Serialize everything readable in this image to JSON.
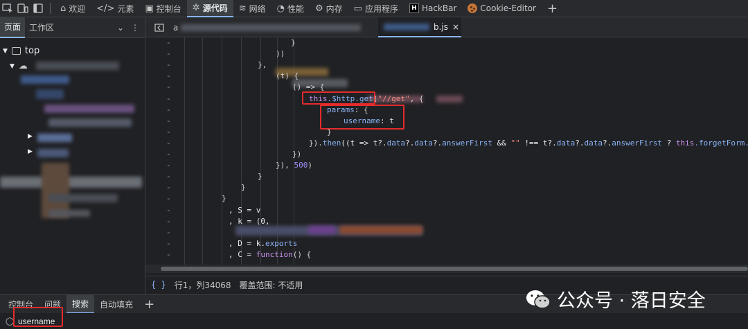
{
  "toolbar": {
    "tabs": [
      {
        "label": "欢迎",
        "icon": "home-icon"
      },
      {
        "label": "元素",
        "icon": "code-brackets-icon"
      },
      {
        "label": "控制台",
        "icon": "console-icon"
      },
      {
        "label": "源代码",
        "icon": "bug-icon"
      },
      {
        "label": "网络",
        "icon": "wifi-icon"
      },
      {
        "label": "性能",
        "icon": "performance-icon"
      },
      {
        "label": "内存",
        "icon": "memory-icon"
      },
      {
        "label": "应用程序",
        "icon": "application-icon"
      },
      {
        "label": "HackBar",
        "icon": "hackbar-icon"
      },
      {
        "label": "Cookie-Editor",
        "icon": "cookie-icon"
      }
    ],
    "add_label": "+"
  },
  "sidebar": {
    "tab_page": "页面",
    "tab_workspace": "工作区",
    "tree_top": "top"
  },
  "editor": {
    "tab_first": "a",
    "tab_active": "b.js",
    "close_glyph": "×",
    "lines": [
      {
        "mark": "-",
        "tokens": [
          {
            "t": "}",
            "c": "t-punc"
          }
        ]
      },
      {
        "mark": "-",
        "tokens": [
          {
            "t": "))",
            "c": "t-punc"
          }
        ]
      },
      {
        "mark": "-",
        "tokens": [
          {
            "t": "},",
            "c": "t-punc"
          }
        ]
      },
      {
        "mark": "-",
        "tokens": [
          {
            "t": "(t) {",
            "c": "t-punc"
          }
        ]
      },
      {
        "mark": "-",
        "tokens": [
          {
            "t": "() => {",
            "c": "t-punc"
          }
        ]
      },
      {
        "mark": "-",
        "tokens": [
          {
            "t": "this",
            "c": "t-kw"
          },
          {
            "t": ".$http.get",
            "c": "t-prop"
          },
          {
            "t": "(",
            "c": "t-punc"
          },
          {
            "t": "\"/",
            "c": "t-str"
          },
          {
            "t": "/get",
            "c": "t-str"
          },
          {
            "t": "\"",
            "c": "t-str"
          },
          {
            "t": ", {",
            "c": "t-punc"
          }
        ]
      },
      {
        "mark": "-",
        "tokens": [
          {
            "t": "params",
            "c": "t-prop"
          },
          {
            "t": ": {",
            "c": "t-punc"
          }
        ]
      },
      {
        "mark": "-",
        "tokens": [
          {
            "t": "username",
            "c": "t-prop"
          },
          {
            "t": ": t",
            "c": "t-plain"
          }
        ]
      },
      {
        "mark": "-",
        "tokens": [
          {
            "t": "}",
            "c": "t-punc"
          }
        ]
      },
      {
        "mark": "-",
        "tokens": [
          {
            "t": "}).",
            "c": "t-punc"
          },
          {
            "t": "then",
            "c": "t-prop"
          },
          {
            "t": "((t => t?.",
            "c": "t-plain"
          },
          {
            "t": "data",
            "c": "t-prop"
          },
          {
            "t": "?.",
            "c": "t-plain"
          },
          {
            "t": "data",
            "c": "t-prop"
          },
          {
            "t": "?.",
            "c": "t-plain"
          },
          {
            "t": "answerFirst",
            "c": "t-prop"
          },
          {
            "t": " && ",
            "c": "t-plain"
          },
          {
            "t": "\"\"",
            "c": "t-str"
          },
          {
            "t": " !== t?.",
            "c": "t-plain"
          },
          {
            "t": "data",
            "c": "t-prop"
          },
          {
            "t": "?.",
            "c": "t-plain"
          },
          {
            "t": "data",
            "c": "t-prop"
          },
          {
            "t": "?.",
            "c": "t-plain"
          },
          {
            "t": "answerFirst",
            "c": "t-prop"
          },
          {
            "t": " ? ",
            "c": "t-plain"
          },
          {
            "t": "this",
            "c": "t-kw"
          },
          {
            "t": ".forgetForm.answ",
            "c": "t-prop"
          }
        ]
      },
      {
        "mark": "-",
        "tokens": [
          {
            "t": "})",
            "c": "t-punc"
          }
        ]
      },
      {
        "mark": "-",
        "tokens": [
          {
            "t": "}), ",
            "c": "t-punc"
          },
          {
            "t": "500",
            "c": "t-num"
          },
          {
            "t": ")",
            "c": "t-punc"
          }
        ]
      },
      {
        "mark": "-",
        "tokens": [
          {
            "t": "}",
            "c": "t-punc"
          }
        ]
      },
      {
        "mark": "-",
        "tokens": [
          {
            "t": "}",
            "c": "t-punc"
          }
        ]
      },
      {
        "mark": "-",
        "tokens": [
          {
            "t": "}",
            "c": "t-punc"
          }
        ]
      },
      {
        "mark": "-",
        "tokens": [
          {
            "t": ", S = v",
            "c": "t-plain"
          }
        ]
      },
      {
        "mark": "-",
        "tokens": [
          {
            "t": ", k = (0,",
            "c": "t-plain"
          }
        ]
      },
      {
        "mark": "-",
        "tokens": []
      },
      {
        "mark": "-",
        "tokens": [
          {
            "t": ", D = k.",
            "c": "t-plain"
          },
          {
            "t": "exports",
            "c": "t-prop"
          }
        ]
      },
      {
        "mark": "-",
        "tokens": [
          {
            "t": ", C = ",
            "c": "t-plain"
          },
          {
            "t": "function",
            "c": "t-kw"
          },
          {
            "t": "() {",
            "c": "t-punc"
          }
        ]
      },
      {
        "mark": "-",
        "tokens": []
      }
    ]
  },
  "status": {
    "braces": "{ }",
    "position": "行1，列34068",
    "coverage": "覆盖范围: 不适用"
  },
  "drawer": {
    "tabs": [
      "控制台",
      "问题",
      "搜索",
      "自动填充"
    ],
    "active_index": 2,
    "add_label": "+",
    "search_value": "username"
  },
  "watermark": {
    "text": "公众号 · 落日安全"
  }
}
